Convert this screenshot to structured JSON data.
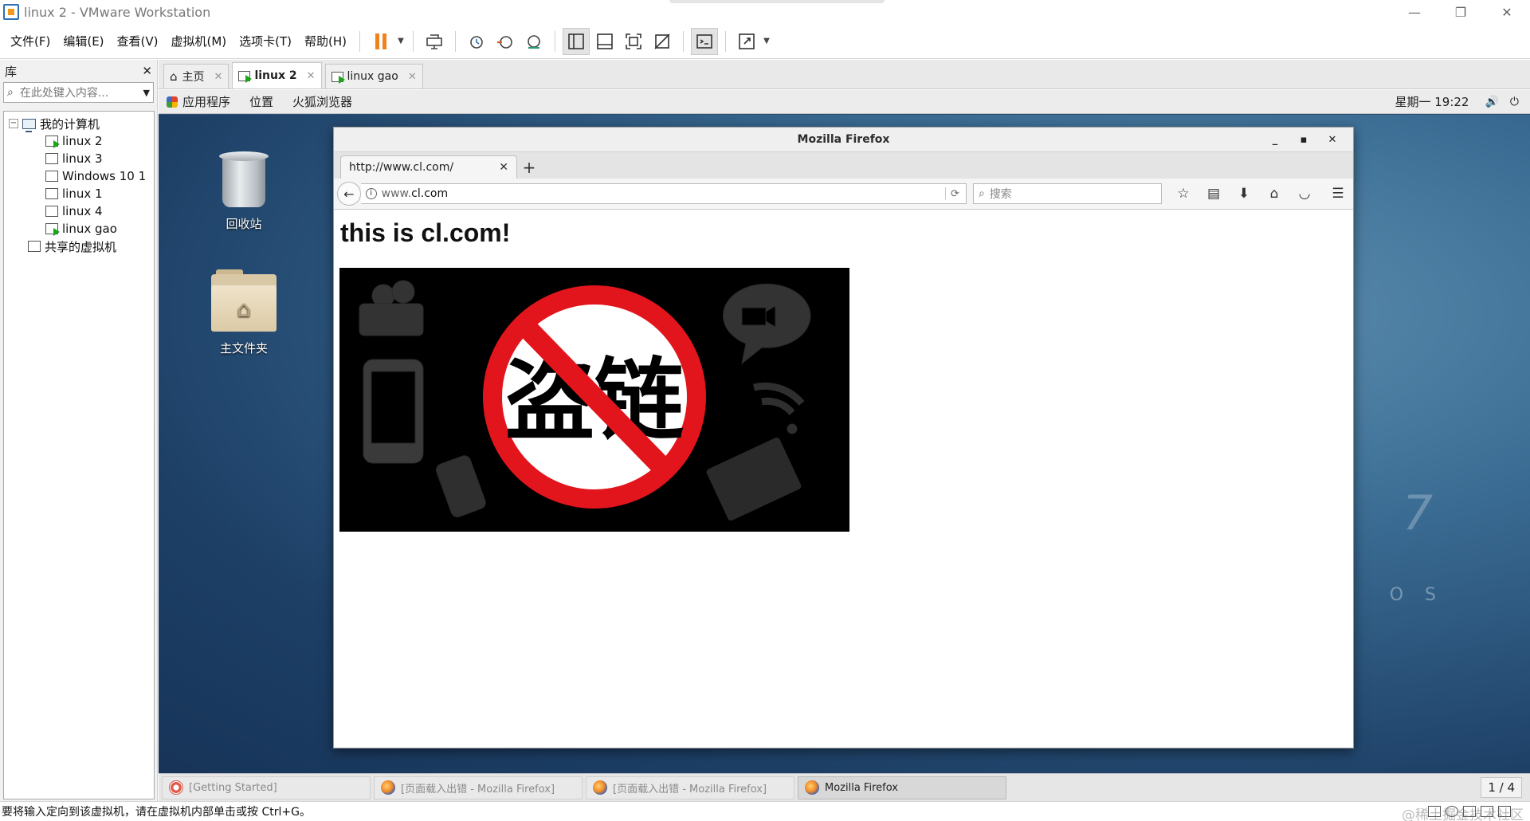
{
  "window": {
    "title": "linux 2 - VMware Workstation",
    "controls": [
      "—",
      "❐",
      "✕"
    ]
  },
  "menu": {
    "items": [
      "文件(F)",
      "编辑(E)",
      "查看(V)",
      "虚拟机(M)",
      "选项卡(T)",
      "帮助(H)"
    ]
  },
  "library": {
    "title": "库",
    "close": "✕",
    "search_placeholder": "在此处键入内容...",
    "root_label": "我的计算机",
    "vms": [
      "linux 2",
      "linux 3",
      "Windows 10 1",
      "linux 1",
      "linux 4",
      "linux gao"
    ],
    "shared_label": "共享的虚拟机"
  },
  "vm_tabs": [
    {
      "label": "主页",
      "close": "✕"
    },
    {
      "label": "linux 2",
      "close": "✕"
    },
    {
      "label": "linux gao",
      "close": "✕"
    }
  ],
  "gnome": {
    "menus": [
      "应用程序",
      "位置",
      "火狐浏览器"
    ],
    "clock": "星期一 19:22",
    "volume_icon": "🔊",
    "power_icon": "⏻"
  },
  "desktop": {
    "icons": [
      "回收站",
      "主文件夹"
    ],
    "os_watermark": "7",
    "os_text": "O S"
  },
  "firefox": {
    "title": "Mozilla Firefox",
    "tab_title": "http://www.cl.com/",
    "tab_close": "✕",
    "new_tab": "+",
    "url_prefix": "www.",
    "url_host": "cl.com",
    "search_placeholder": "搜索",
    "page_heading": "this is cl.com!",
    "image_text": "盗链"
  },
  "taskbar": {
    "items": [
      "[Getting Started]",
      "[页面载入出错 - Mozilla Firefox]",
      "[页面载入出错 - Mozilla Firefox]",
      "Mozilla Firefox"
    ],
    "pager": "1 / 4"
  },
  "statusbar": {
    "message": "要将输入定向到该虚拟机，请在虚拟机内部单击或按 Ctrl+G。",
    "watermark": "@稀土掘金技术社区"
  },
  "colors": {
    "accent": "#2b6fb6",
    "pause": "#f0811f",
    "no_sign": "#e3151c"
  }
}
